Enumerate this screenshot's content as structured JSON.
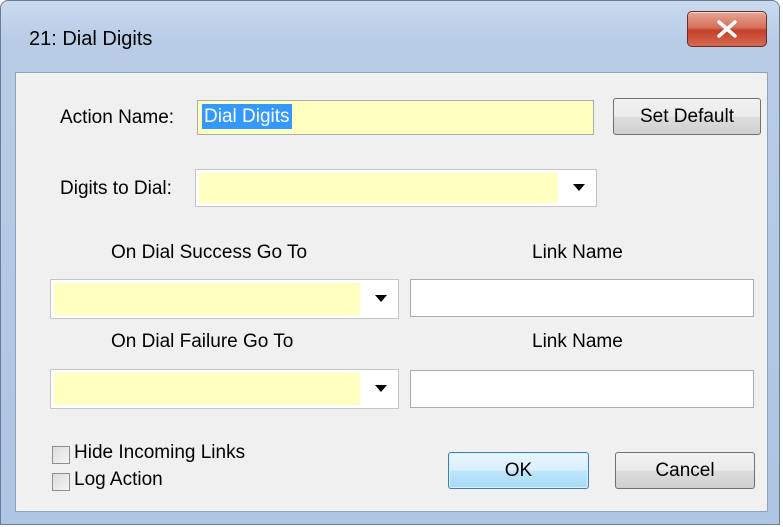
{
  "window": {
    "title": "21: Dial Digits"
  },
  "action_name": {
    "label": "Action Name:",
    "value": "Dial Digits"
  },
  "set_default_button": "Set Default",
  "digits_to_dial": {
    "label": "Digits to Dial:",
    "value": ""
  },
  "success": {
    "header": "On Dial Success Go To",
    "link_header": "Link Name",
    "goto_value": "",
    "link_value": ""
  },
  "failure": {
    "header": "On Dial Failure Go To",
    "link_header": "Link Name",
    "goto_value": "",
    "link_value": ""
  },
  "checkboxes": {
    "hide_incoming_links": {
      "label": "Hide Incoming Links",
      "checked": false
    },
    "log_action": {
      "label": "Log Action",
      "checked": false
    }
  },
  "buttons": {
    "ok": "OK",
    "cancel": "Cancel"
  },
  "colors": {
    "field_highlight": "#ffffc0",
    "selection": "#3399ff"
  },
  "icons": {
    "close": "close-x-icon",
    "dropdown": "triangle-down-icon"
  }
}
